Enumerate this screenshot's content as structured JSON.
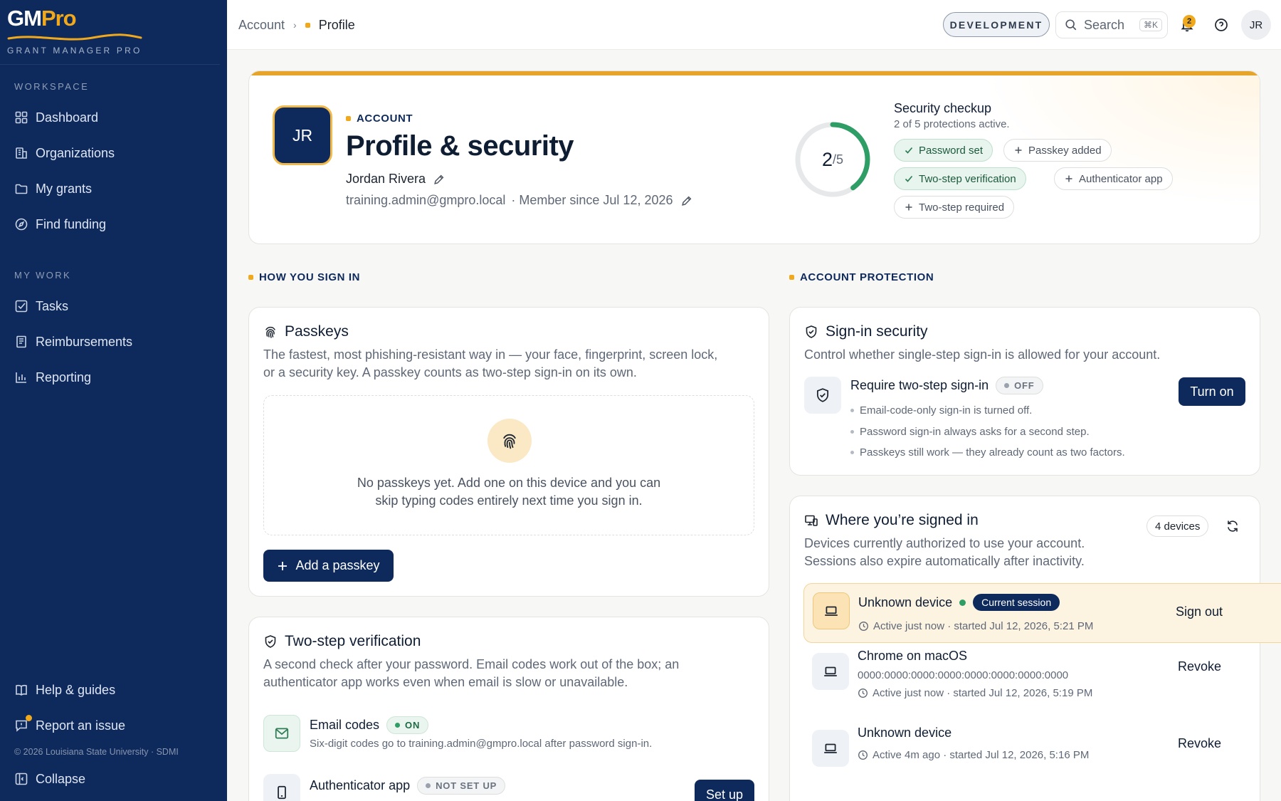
{
  "brand": {
    "name_main": "GM",
    "name_accent": "Pro",
    "tagline": "GRANT MANAGER PRO"
  },
  "sidebar": {
    "section_workspace": "WORKSPACE",
    "workspace_items": [
      {
        "label": "Dashboard",
        "icon": "dashboard-icon"
      },
      {
        "label": "Organizations",
        "icon": "building-icon"
      },
      {
        "label": "My grants",
        "icon": "folder-icon"
      },
      {
        "label": "Find funding",
        "icon": "compass-icon"
      }
    ],
    "section_mywork": "MY WORK",
    "mywork_items": [
      {
        "label": "Tasks",
        "icon": "checkbox-icon"
      },
      {
        "label": "Reimbursements",
        "icon": "receipt-icon"
      },
      {
        "label": "Reporting",
        "icon": "bar-chart-icon"
      }
    ],
    "help": "Help & guides",
    "report": "Report an issue",
    "copyright": "© 2026 Louisiana State University · SDMI",
    "collapse": "Collapse"
  },
  "topbar": {
    "breadcrumb": [
      "Account",
      "Profile"
    ],
    "environment": "DEVELOPMENT",
    "search_label": "Search",
    "search_shortcut": "⌘K",
    "notification_count": "2",
    "user_initials": "JR"
  },
  "profile": {
    "eyebrow": "ACCOUNT",
    "title": "Profile & security",
    "initials": "JR",
    "name": "Jordan Rivera",
    "email": "training.admin@gmpro.local",
    "member_since": "· Member since Jul 12, 2026"
  },
  "security_checkup": {
    "score": "2",
    "total": "/5",
    "score_fraction": 0.4,
    "title": "Security checkup",
    "subtitle": "2 of 5 protections active.",
    "chips": [
      {
        "label": "Password set",
        "active": true
      },
      {
        "label": "Passkey added",
        "active": false
      },
      {
        "label": "Two-step verification",
        "active": true
      },
      {
        "label": "Authenticator app",
        "active": false
      },
      {
        "label": "Two-step required",
        "active": false
      }
    ]
  },
  "sections": {
    "sign_in": "HOW YOU SIGN IN",
    "protection": "ACCOUNT PROTECTION"
  },
  "passkeys": {
    "title": "Passkeys",
    "desc_1": "The fastest, most phishing-resistant way in — your face, fingerprint, screen lock,",
    "desc_2": "or a security key. A passkey counts as two-step sign-in on its own.",
    "empty_1": "No passkeys yet. Add one on this device and you can",
    "empty_2": "skip typing codes entirely next time you sign in.",
    "add_button": "Add a passkey"
  },
  "two_step": {
    "title": "Two-step verification",
    "desc_1": "A second check after your password. Email codes work out of the box; an",
    "desc_2": "authenticator app works even when email is slow or unavailable.",
    "email_title": "Email codes",
    "email_state": "ON",
    "email_sub": "Six-digit codes go to training.admin@gmpro.local after password sign-in.",
    "app_title": "Authenticator app",
    "app_state": "NOT SET UP",
    "app_button": "Set up"
  },
  "signin_security": {
    "title": "Sign-in security",
    "desc": "Control whether single-step sign-in is allowed for your account.",
    "require_title": "Require two-step sign-in",
    "require_state": "OFF",
    "bullets": [
      "Email-code-only sign-in is turned off.",
      "Password sign-in always asks for a second step.",
      "Passkeys still work — they already count as two factors."
    ],
    "turn_on": "Turn on"
  },
  "sessions": {
    "title": "Where you’re signed in",
    "count": "4 devices",
    "desc_1": "Devices currently authorized to use your account.",
    "desc_2": "Sessions also expire automatically after inactivity.",
    "current_badge": "Current session",
    "devices": [
      {
        "name": "Unknown device",
        "ip": "",
        "meta": "Active just now · started Jul 12, 2026, 5:21 PM",
        "action": "Sign out"
      },
      {
        "name": "Chrome on macOS",
        "ip": "0000:0000:0000:0000:0000:0000:0000:0000",
        "meta": "Active just now · started Jul 12, 2026, 5:19 PM",
        "action": "Revoke"
      },
      {
        "name": "Unknown device",
        "ip": "",
        "meta": "Active 4m ago · started Jul 12, 2026, 5:16 PM",
        "action": "Revoke"
      }
    ]
  }
}
